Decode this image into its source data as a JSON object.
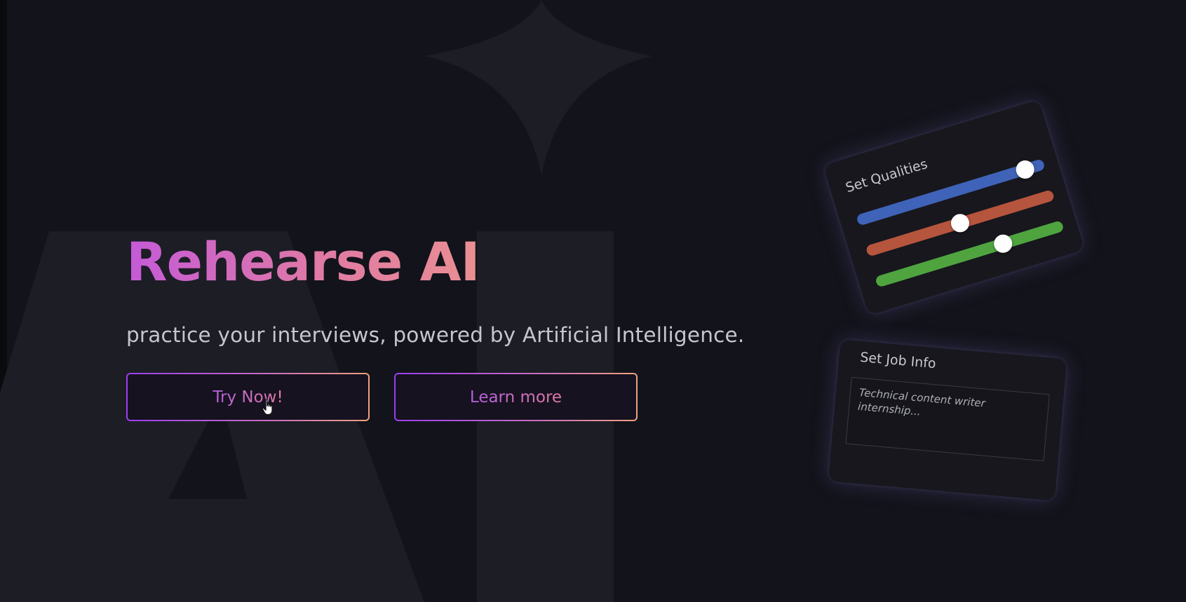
{
  "hero": {
    "title": "Rehearse AI",
    "subtitle": "practice your interviews, powered by Artificial Intelligence."
  },
  "buttons": {
    "try_now": "Try Now!",
    "learn_more": "Learn more"
  },
  "qualities_card": {
    "title": "Set Qualities",
    "sliders": [
      {
        "color": "#3f63b8",
        "value": 0.9
      },
      {
        "color": "#b6553d",
        "value": 0.5
      },
      {
        "color": "#4fa43f",
        "value": 0.68
      }
    ]
  },
  "job_card": {
    "title": "Set Job Info",
    "input_placeholder": "Technical content writer internship..."
  },
  "colors": {
    "background": "#13131b",
    "title_gradient_start": "#c45ad8",
    "title_gradient_end": "#ea8f92",
    "button_border_start": "#9a3ff0",
    "button_border_end": "#f0a07e"
  },
  "icons": {
    "cursor": "hand-pointer-icon",
    "background_shapes": [
      "sparkle-star-icon",
      "letter-a-shape",
      "letter-i-shape"
    ]
  }
}
